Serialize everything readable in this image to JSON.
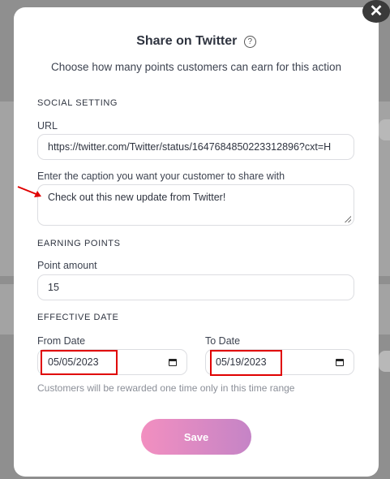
{
  "modal": {
    "title": "Share on Twitter",
    "subtitle": "Choose how many points customers can earn for this action",
    "close_icon": "close-icon",
    "help_icon": "question-circle-icon"
  },
  "social_setting": {
    "heading": "SOCIAL SETTING",
    "url_label": "URL",
    "url_value": "https://twitter.com/Twitter/status/1647684850223312896?cxt=H",
    "caption_label": "Enter the caption you want your customer to share with",
    "caption_value": "Check out this new update from Twitter!"
  },
  "earning_points": {
    "heading": "EARNING POINTS",
    "amount_label": "Point amount",
    "amount_value": "15"
  },
  "effective_date": {
    "heading": "EFFECTIVE DATE",
    "from_label": "From Date",
    "from_value": "05/05/2023",
    "to_label": "To Date",
    "to_value": "05/19/2023",
    "hint": "Customers will be rewarded one time only in this time range"
  },
  "actions": {
    "save_label": "Save"
  },
  "colors": {
    "save_gradient_start": "#f28fc0",
    "save_gradient_end": "#c584c6",
    "annotation_red": "#e00000"
  },
  "icons": {
    "calendar": "calendar-icon",
    "arrow": "red-arrow-annotation"
  }
}
